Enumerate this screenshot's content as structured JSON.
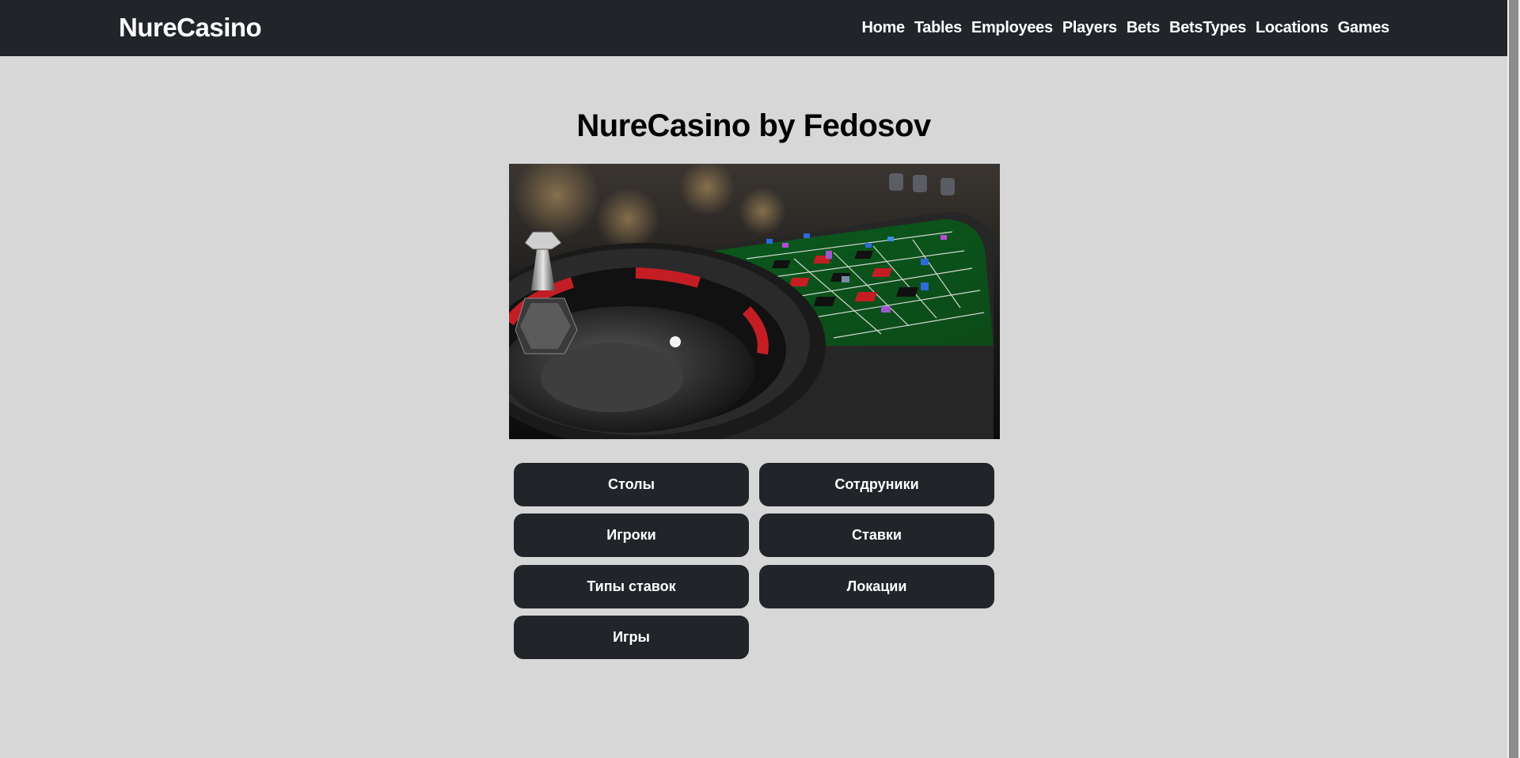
{
  "navbar": {
    "brand": "NureCasino",
    "links": [
      "Home",
      "Tables",
      "Employees",
      "Players",
      "Bets",
      "BetsTypes",
      "Locations",
      "Games"
    ]
  },
  "main": {
    "title": "NureCasino by Fedosov",
    "buttons": [
      "Столы",
      "Сотдруники",
      "Игроки",
      "Ставки",
      "Типы ставок",
      "Локации",
      "Игры"
    ]
  },
  "colors": {
    "navbar_bg": "#212529",
    "page_bg": "#d7d7d7",
    "button_bg": "#212529",
    "text_light": "#ffffff"
  }
}
